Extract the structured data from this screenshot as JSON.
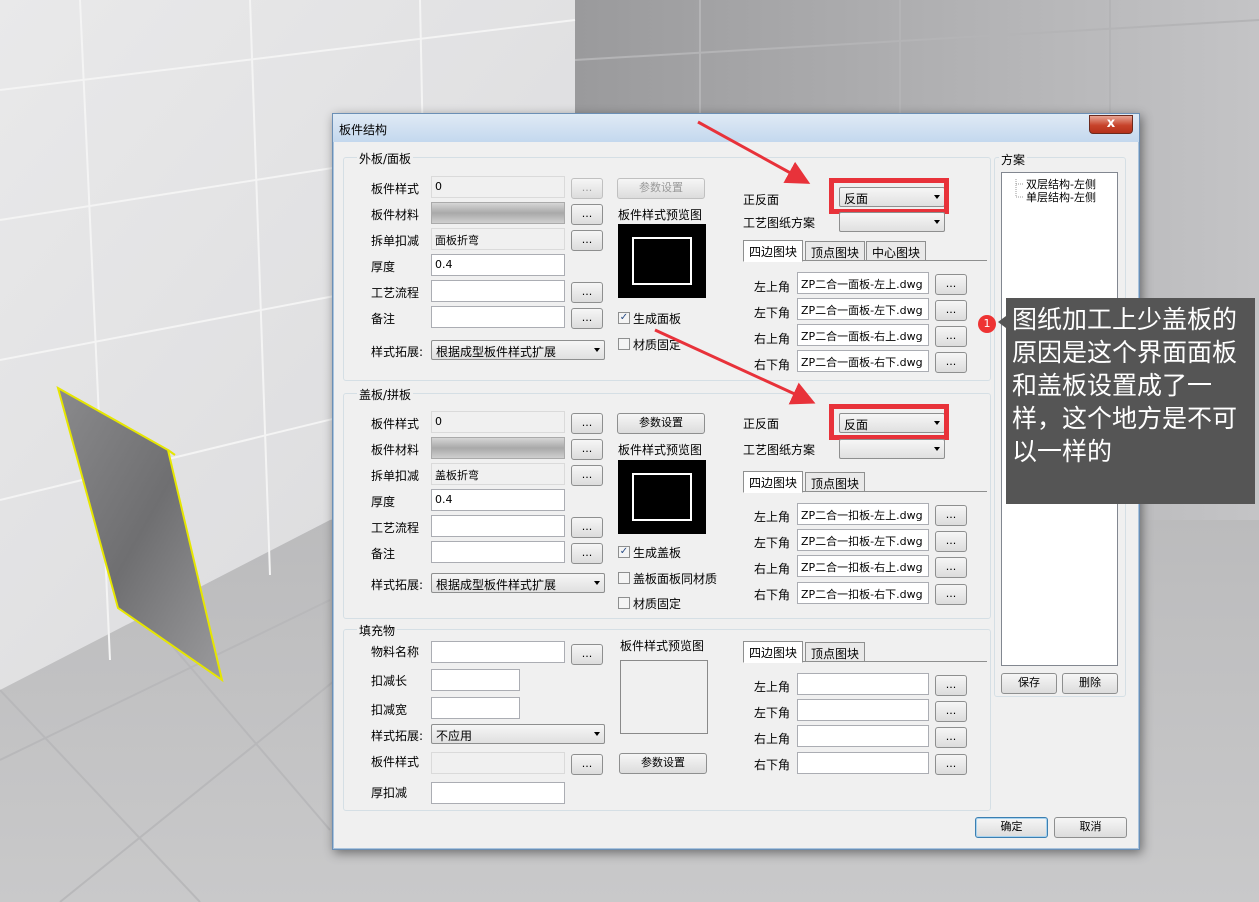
{
  "window": {
    "title": "板件结构",
    "close": "x"
  },
  "outer": {
    "group_label": "外板/面板",
    "style_label": "板件样式",
    "style_value": "0",
    "material_label": "板件材料",
    "fold_label": "拆单扣减",
    "fold_value": "面板折弯",
    "thickness_label": "厚度",
    "thickness_value": "0.4",
    "process_label": "工艺流程",
    "note_label": "备注",
    "ext_label": "样式拓展:",
    "ext_value": "根据成型板件样式扩展",
    "param_btn": "参数设置",
    "preview_label": "板件样式预览图",
    "gen_label": "生成面板",
    "gen_checked": true,
    "matfix_label": "材质固定",
    "matfix_checked": false,
    "side_label": "正反面",
    "side_value": "反面",
    "plan_label": "工艺图纸方案",
    "tabs": [
      "四边图块",
      "顶点图块",
      "中心图块"
    ],
    "corners": [
      {
        "label": "左上角",
        "value": "ZP二合一面板-左上.dwg"
      },
      {
        "label": "左下角",
        "value": "ZP二合一面板-左下.dwg"
      },
      {
        "label": "右上角",
        "value": "ZP二合一面板-右上.dwg"
      },
      {
        "label": "右下角",
        "value": "ZP二合一面板-右下.dwg"
      }
    ]
  },
  "cover": {
    "group_label": "盖板/拼板",
    "style_label": "板件样式",
    "style_value": "0",
    "material_label": "板件材料",
    "fold_label": "拆单扣减",
    "fold_value": "盖板折弯",
    "thickness_label": "厚度",
    "thickness_value": "0.4",
    "process_label": "工艺流程",
    "note_label": "备注",
    "ext_label": "样式拓展:",
    "ext_value": "根据成型板件样式扩展",
    "param_btn": "参数设置",
    "preview_label": "板件样式预览图",
    "gen_label": "生成盖板",
    "gen_checked": true,
    "samemat_label": "盖板面板同材质",
    "samemat_checked": false,
    "matfix_label": "材质固定",
    "matfix_checked": false,
    "side_label": "正反面",
    "side_value": "反面",
    "plan_label": "工艺图纸方案",
    "tabs": [
      "四边图块",
      "顶点图块"
    ],
    "corners": [
      {
        "label": "左上角",
        "value": "ZP二合一扣板-左上.dwg"
      },
      {
        "label": "左下角",
        "value": "ZP二合一扣板-左下.dwg"
      },
      {
        "label": "右上角",
        "value": "ZP二合一扣板-右上.dwg"
      },
      {
        "label": "右下角",
        "value": "ZP二合一扣板-右下.dwg"
      }
    ]
  },
  "filler": {
    "group_label": "填充物",
    "name_label": "物料名称",
    "len_label": "扣减长",
    "width_label": "扣减宽",
    "ext_label": "样式拓展:",
    "ext_value": "不应用",
    "style_label": "板件样式",
    "thick_label": "厚扣减",
    "preview_label": "板件样式预览图",
    "param_btn": "参数设置",
    "tabs": [
      "四边图块",
      "顶点图块"
    ],
    "corners": [
      {
        "label": "左上角",
        "value": ""
      },
      {
        "label": "左下角",
        "value": ""
      },
      {
        "label": "右上角",
        "value": ""
      },
      {
        "label": "右下角",
        "value": ""
      }
    ]
  },
  "scheme": {
    "label": "方案",
    "items": [
      "双层结构-左侧",
      "单层结构-左侧"
    ],
    "save": "保存",
    "delete": "删除"
  },
  "footer": {
    "ok": "确定",
    "cancel": "取消"
  },
  "ellipsis": "...",
  "annotation": {
    "badge": "1",
    "text": "图纸加工上少盖板的原因是这个界面面板和盖板设置成了一样，这个地方是不可以一样的"
  },
  "colors": {
    "highlight": "#e8323a",
    "callout_bg": "#555555"
  }
}
